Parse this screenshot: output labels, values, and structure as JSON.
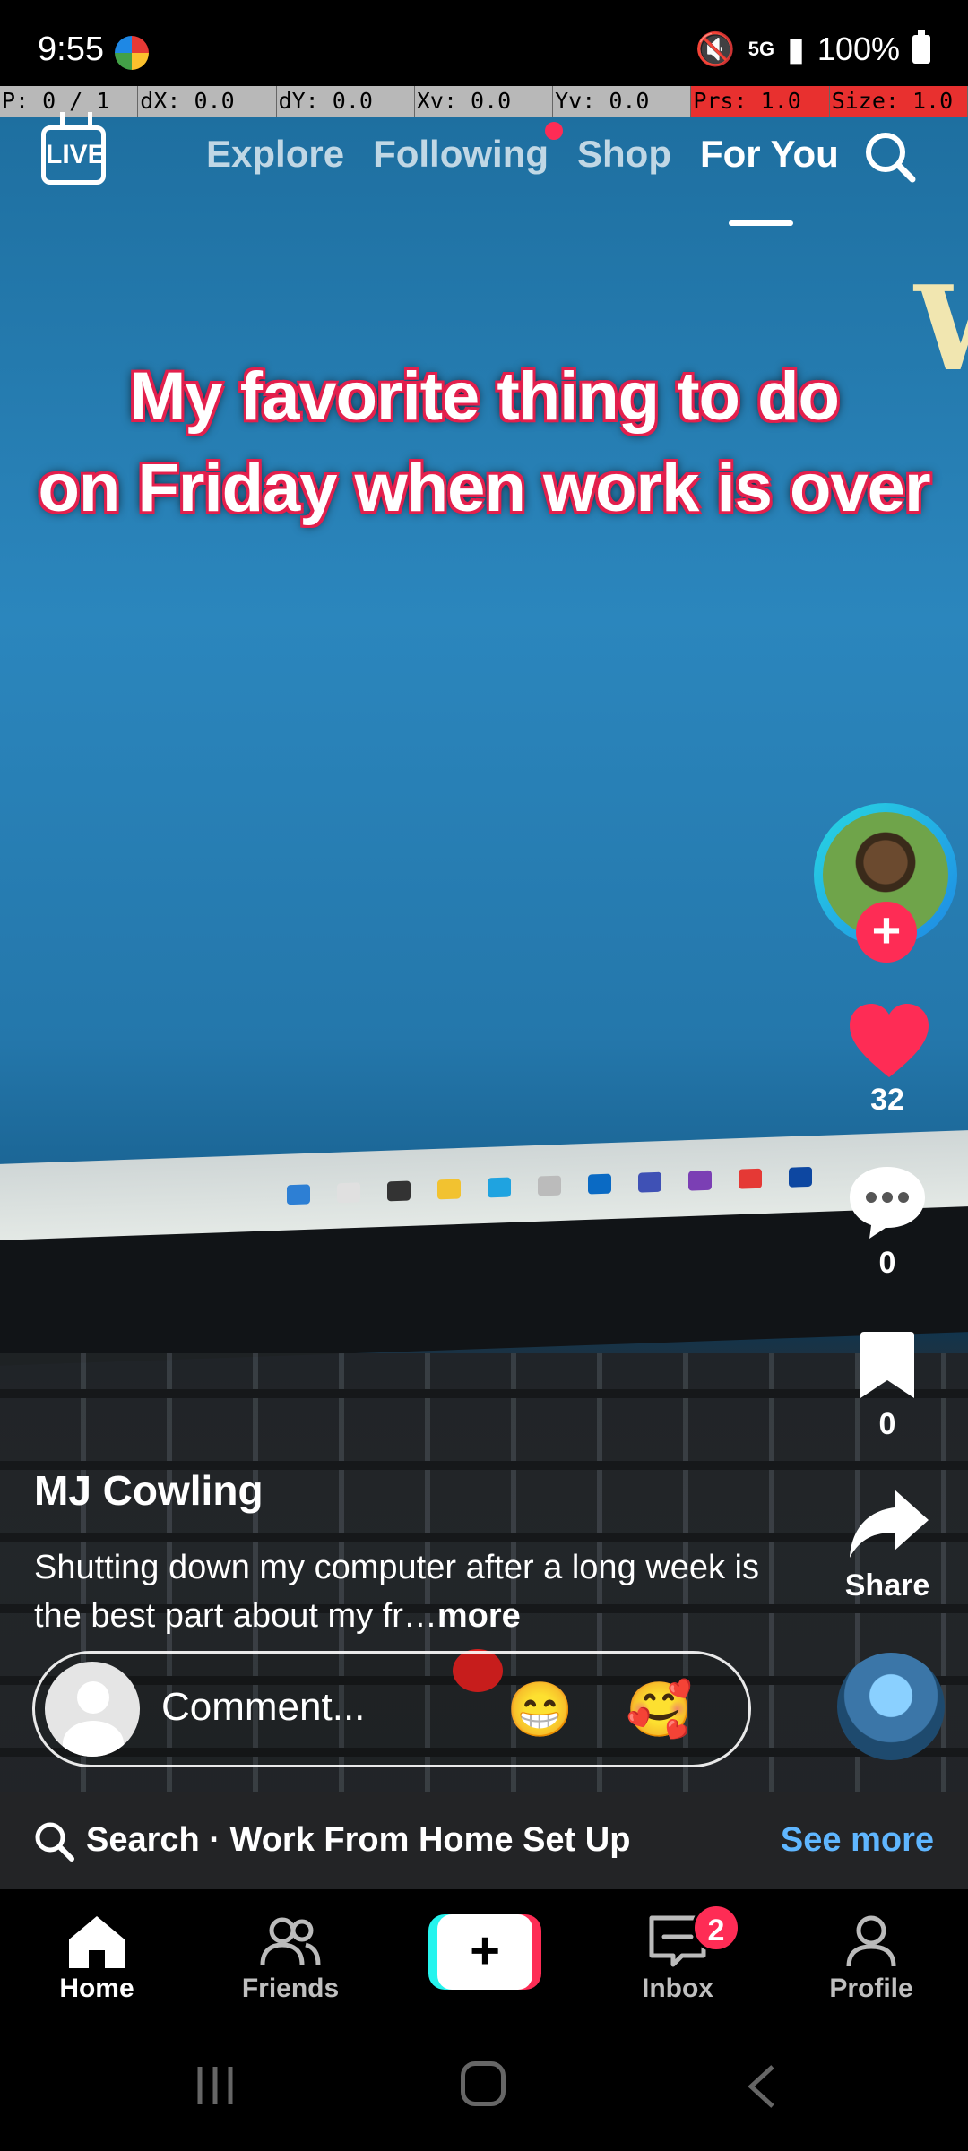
{
  "status_bar": {
    "time": "9:55",
    "network": "5G",
    "battery": "100%"
  },
  "debug_bar": {
    "cells": [
      "P: 0 / 1",
      "dX: 0.0",
      "dY: 0.0",
      "Xv: 0.0",
      "Yv: 0.0",
      "Prs: 1.0",
      "Size: 1.0"
    ]
  },
  "top_nav": {
    "live_label": "LIVE",
    "tabs": [
      {
        "label": "Explore"
      },
      {
        "label": "Following"
      },
      {
        "label": "Shop"
      },
      {
        "label": "For You"
      }
    ],
    "active_tab": "For You"
  },
  "video": {
    "caption_line1": "My favorite thing to do",
    "caption_line2": "on Friday when work is over"
  },
  "right_rail": {
    "likes": "32",
    "comments": "0",
    "saves": "0",
    "share_label": "Share"
  },
  "post": {
    "username": "MJ Cowling",
    "description": "Shutting down my computer after a long week is the best part about my fr…",
    "more_label": "more"
  },
  "comment_bar": {
    "placeholder": "Comment...",
    "emoji1": "😁",
    "emoji2": "🥰"
  },
  "search_suggestion": {
    "text": "Search · Work From Home Set Up",
    "see_more": "See more"
  },
  "bottom_nav": {
    "home": "Home",
    "friends": "Friends",
    "inbox": "Inbox",
    "inbox_badge": "2",
    "profile": "Profile",
    "create_symbol": "+"
  },
  "colors": {
    "accent_red": "#fe2c55",
    "accent_cyan": "#25f4ee",
    "see_more_blue": "#5fb6ff"
  }
}
